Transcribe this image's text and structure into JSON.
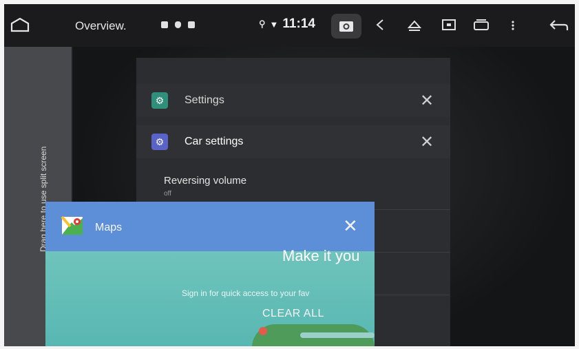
{
  "topbar": {
    "title": "Overview.",
    "time": "11:14",
    "icons": [
      "home-icon",
      "notification-icon",
      "shield-icon",
      "sd-card-icon",
      "location-icon",
      "wifi-icon",
      "camera-icon",
      "volume-icon",
      "eject-icon",
      "screen-icon",
      "window-icon",
      "more-icon",
      "back-icon"
    ]
  },
  "dropzone": {
    "label": "Drag here to use split screen"
  },
  "settings_card": {
    "rows": [
      {
        "label": "Settings",
        "icon": "gear-icon",
        "color": "#2f8f7a"
      },
      {
        "label": "Car settings",
        "icon": "gear-icon",
        "color": "#5a63c8"
      }
    ],
    "preference": {
      "title": "Reversing volume",
      "value": "off"
    }
  },
  "maps_card": {
    "label": "Maps",
    "headline": "Make it you",
    "subtext": "Sign in for quick access to your fav"
  },
  "clear_all": "CLEAR ALL",
  "colors": {
    "maps_header": "#5d8fd8",
    "maps_body": "#6fc4bc",
    "dropzone": "#48494c"
  }
}
